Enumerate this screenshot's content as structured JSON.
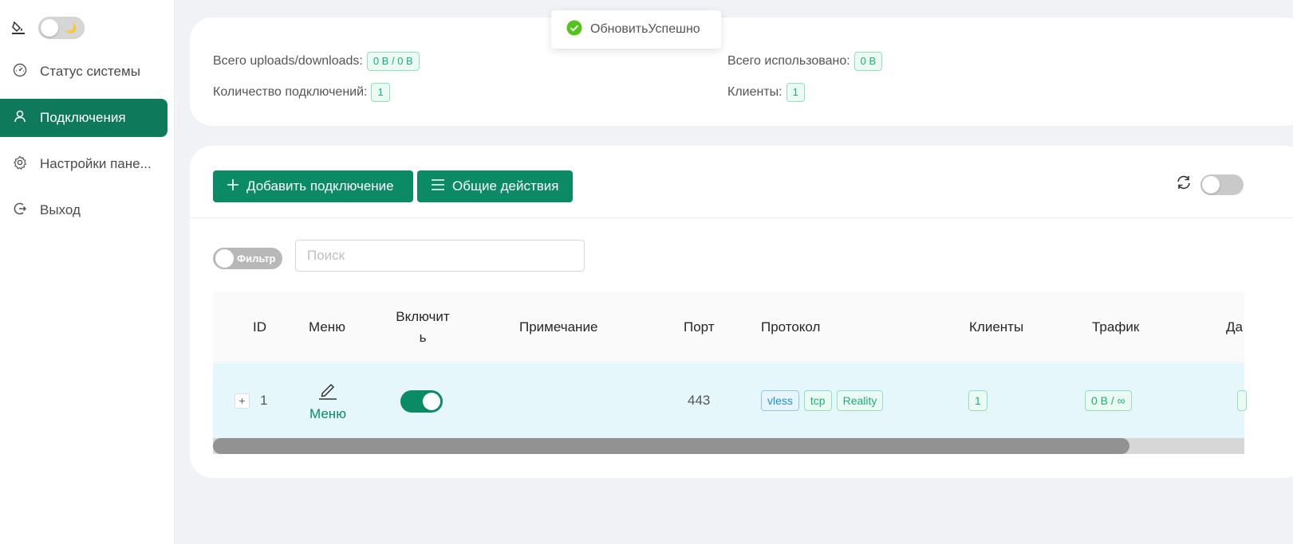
{
  "sidebar": {
    "theme_icon": "paint-bucket-icon",
    "moon_glyph": "🌙",
    "items": [
      {
        "label": "Статус системы",
        "icon": "dashboard-icon",
        "active": false
      },
      {
        "label": "Подключения",
        "icon": "user-icon",
        "active": true
      },
      {
        "label": "Настройки пане...",
        "icon": "gear-icon",
        "active": false
      },
      {
        "label": "Выход",
        "icon": "logout-icon",
        "active": false
      }
    ]
  },
  "toast": {
    "text": "ОбновитьУспешно",
    "icon": "check-circle-icon"
  },
  "stats": {
    "total_ud_label": "Всего uploads/downloads:",
    "total_ud_value": "0 B / 0 B",
    "total_used_label": "Всего использовано:",
    "total_used_value": "0 B",
    "connections_label": "Количество подключений:",
    "connections_value": "1",
    "clients_label": "Клиенты:",
    "clients_value": "1"
  },
  "toolbar": {
    "add_label": "Добавить подключение",
    "general_label": "Общие действия"
  },
  "filter": {
    "toggle_label": "Фильтр",
    "search_placeholder": "Поиск"
  },
  "table": {
    "columns": [
      "ID",
      "Меню",
      "Включить",
      "Примечание",
      "Порт",
      "Протокол",
      "Клиенты",
      "Трафик",
      "Да"
    ],
    "rows": [
      {
        "id": "1",
        "menu_label": "Меню",
        "enabled": true,
        "remark": "",
        "port": "443",
        "protocol_tags": [
          "vless",
          "tcp",
          "Reality"
        ],
        "clients": "1",
        "traffic": "0 B / ∞"
      }
    ]
  },
  "colors": {
    "primary": "#0b8a66",
    "active_nav": "#0f7a5b",
    "tag_green": "#17b07d",
    "tag_blue": "#1a8fd6"
  }
}
